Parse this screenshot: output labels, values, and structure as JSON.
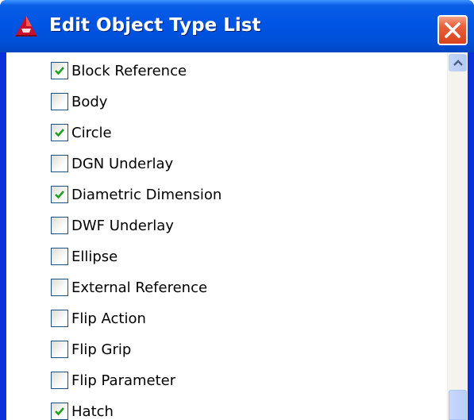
{
  "window": {
    "title": "Edit Object Type List",
    "app_icon": "autocad-logo-icon",
    "close_icon": "close-icon"
  },
  "items": [
    {
      "label": "Block Reference",
      "checked": true
    },
    {
      "label": "Body",
      "checked": false
    },
    {
      "label": "Circle",
      "checked": true
    },
    {
      "label": "DGN Underlay",
      "checked": false
    },
    {
      "label": "Diametric Dimension",
      "checked": true
    },
    {
      "label": "DWF Underlay",
      "checked": false
    },
    {
      "label": "Ellipse",
      "checked": false
    },
    {
      "label": "External Reference",
      "checked": false
    },
    {
      "label": "Flip Action",
      "checked": false
    },
    {
      "label": "Flip Grip",
      "checked": false
    },
    {
      "label": "Flip Parameter",
      "checked": false
    },
    {
      "label": "Hatch",
      "checked": true
    }
  ],
  "colors": {
    "titlebar": "#0054e3",
    "checkmark": "#21a121",
    "close_button": "#e05a36"
  }
}
